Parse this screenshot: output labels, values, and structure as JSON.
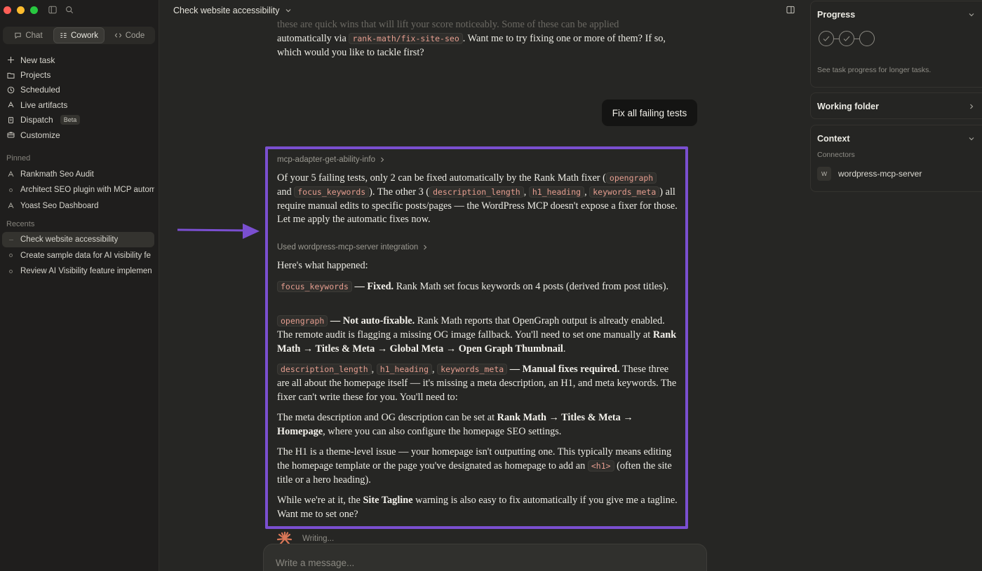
{
  "sidebar": {
    "modes": [
      {
        "label": "Chat",
        "icon": "chat-bubble-icon"
      },
      {
        "label": "Cowork",
        "icon": "cowork-icon"
      },
      {
        "label": "Code",
        "icon": "code-icon"
      }
    ],
    "nav": [
      {
        "label": "New task",
        "icon": "plus-icon"
      },
      {
        "label": "Projects",
        "icon": "folder-icon"
      },
      {
        "label": "Scheduled",
        "icon": "clock-icon"
      },
      {
        "label": "Live artifacts",
        "icon": "artifacts-icon"
      },
      {
        "label": "Dispatch",
        "icon": "dispatch-icon",
        "badge": "Beta"
      },
      {
        "label": "Customize",
        "icon": "briefcase-icon"
      }
    ],
    "pinned_label": "Pinned",
    "pinned": [
      {
        "label": "Rankmath Seo Audit",
        "icon": "artifacts-icon"
      },
      {
        "label": "Architect SEO plugin with MCP autom",
        "icon": "circle-icon"
      },
      {
        "label": "Yoast Seo Dashboard",
        "icon": "artifacts-icon"
      }
    ],
    "recents_label": "Recents",
    "recents": [
      {
        "label": "Check website accessibility",
        "icon": "ellipsis-icon"
      },
      {
        "label": "Create sample data for AI visibility fe",
        "icon": "circle-icon"
      },
      {
        "label": "Review AI Visibility feature implemen",
        "icon": "circle-icon"
      }
    ]
  },
  "header": {
    "title": "Check website accessibility"
  },
  "conversation": {
    "top_message": {
      "faded_line": "these are quick wins that will lift your score noticeably. Some of these can be applied",
      "line_prefix": "automatically via",
      "code": "rank-math/fix-site-seo",
      "line_suffix": ". Want me to try fixing one or more of them? If so, which would you like to tackle first?"
    },
    "user_message": "Fix all failing tests",
    "tool_call_1": "mcp-adapter-get-ability-info",
    "intro": {
      "t1": "Of your 5 failing tests, only 2 can be fixed automatically by the Rank Math fixer (",
      "c1": "opengraph",
      "t2": "and",
      "c2": "focus_keywords",
      "t3": "). The other 3 (",
      "c3": "description_length",
      "c4": "h1_heading",
      "c5": "keywords_meta",
      "t4": ") all require manual edits to specific posts/pages — the WordPress MCP doesn't expose a fixer for those. Let me apply the automatic fixes now.",
      "comma": ","
    },
    "tool_call_2": "Used wordpress-mcp-server integration",
    "happened": "Here's what happened:",
    "item1": {
      "code": "focus_keywords",
      "bold": "— Fixed.",
      "text": "Rank Math set focus keywords on 4 posts (derived from post titles)."
    },
    "item2": {
      "code": "opengraph",
      "bold": "— Not auto-fixable.",
      "text": "Rank Math reports that OpenGraph output is already enabled. The remote audit is flagging a missing OG image fallback. You'll need to set one manually at",
      "bold_path": "Rank Math → Titles & Meta → Global Meta → Open Graph Thumbnail",
      "end": "."
    },
    "item3": {
      "code1": "description_length",
      "code2": "h1_heading",
      "code3": "keywords_meta",
      "bold": "— Manual fixes required.",
      "text": "These three are all about the homepage itself — it's missing a meta description, an H1, and meta keywords. The fixer can't write these for you. You'll need to:"
    },
    "item4": {
      "text1": "The meta description and OG description can be set at",
      "bold_path": "Rank Math → Titles & Meta → Homepage",
      "text2": ", where you can also configure the homepage SEO settings."
    },
    "item5": {
      "text1": "The H1 is a theme-level issue — your homepage isn't outputting one. This typically means editing the homepage template or the page you've designated as homepage to add an",
      "code": "<h1>",
      "text2": "(often the site title or a hero heading)."
    },
    "item6": {
      "text1": "While we're at it, the",
      "bold": "Site Tagline",
      "text2": "warning is also easy to fix automatically if you give me a tagline. Want me to set one?"
    },
    "writing_label": "Writing..."
  },
  "composer": {
    "placeholder": "Write a message..."
  },
  "right_panel": {
    "progress": {
      "title": "Progress",
      "hint": "See task progress for longer tasks.",
      "steps_completed": 2,
      "steps_total": 3
    },
    "working_folder": {
      "title": "Working folder"
    },
    "context": {
      "title": "Context",
      "connectors_label": "Connectors",
      "connectors": [
        {
          "badge": "W",
          "name": "wordpress-mcp-server"
        }
      ]
    }
  },
  "colors": {
    "highlight_border": "#7a4fd0",
    "accent_logo": "#d97757",
    "code_text": "#e59d8f"
  }
}
